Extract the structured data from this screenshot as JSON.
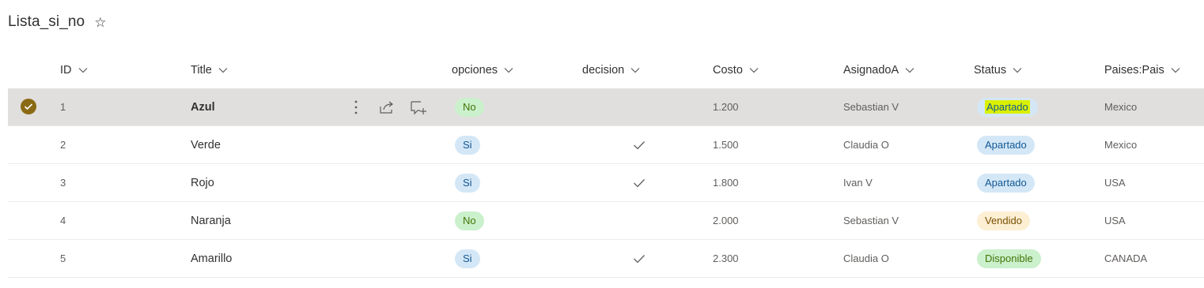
{
  "list": {
    "title": "Lista_si_no"
  },
  "columns": {
    "id": "ID",
    "title": "Title",
    "opciones": "opciones",
    "decision": "decision",
    "costo": "Costo",
    "asignado": "AsignadoA",
    "status": "Status",
    "paises": "Paises:Pais"
  },
  "rows": [
    {
      "id": "1",
      "title": "Azul",
      "opciones": "No",
      "decision": false,
      "costo": "1.200",
      "asignado": "Sebastian V",
      "status": "Apartado",
      "pais": "Mexico",
      "selected": true
    },
    {
      "id": "2",
      "title": "Verde",
      "opciones": "Si",
      "decision": true,
      "costo": "1.500",
      "asignado": "Claudia O",
      "status": "Apartado",
      "pais": "Mexico"
    },
    {
      "id": "3",
      "title": "Rojo",
      "opciones": "Si",
      "decision": true,
      "costo": "1.800",
      "asignado": "Ivan V",
      "status": "Apartado",
      "pais": "USA"
    },
    {
      "id": "4",
      "title": "Naranja",
      "opciones": "No",
      "decision": false,
      "costo": "2.000",
      "asignado": "Sebastian V",
      "status": "Vendido",
      "pais": "USA"
    },
    {
      "id": "5",
      "title": "Amarillo",
      "opciones": "Si",
      "decision": true,
      "costo": "2.300",
      "asignado": "Claudia O",
      "status": "Disponible",
      "pais": "CANADA"
    }
  ],
  "icons": {
    "favorite": "star-outline-icon",
    "sort": "chevron-down-icon",
    "select": "checkmark-circle-icon",
    "more": "more-vertical-icon",
    "share": "share-icon",
    "comment": "add-comment-icon",
    "decision_true": "checkmark-icon"
  },
  "colors": {
    "selected_row": "#e1dfdd",
    "select_circle": "#8a6a14",
    "highlight": "#d9f000"
  }
}
